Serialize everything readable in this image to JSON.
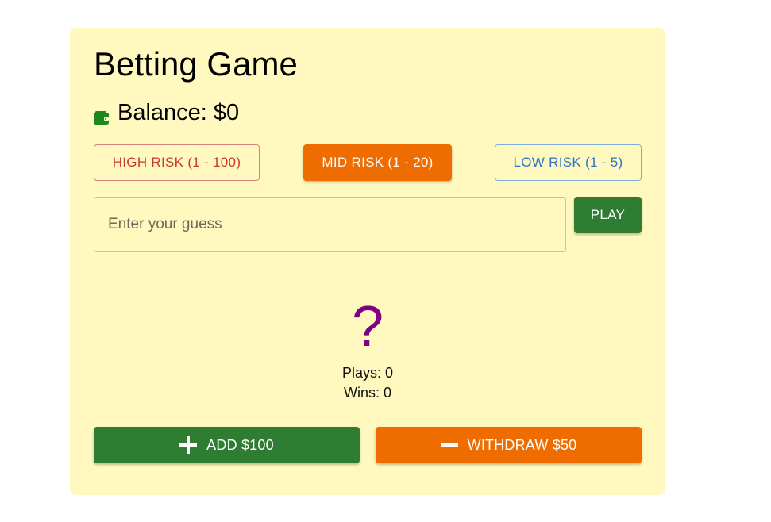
{
  "app": {
    "title": "Betting Game"
  },
  "balance": {
    "label": "Balance: $0",
    "icon": "wallet-icon",
    "icon_color": "#1b8a1b"
  },
  "risk_levels": {
    "high": "HIGH RISK (1 - 100)",
    "mid": "MID RISK (1 - 20)",
    "low": "LOW RISK (1 - 5)",
    "selected": "mid"
  },
  "guess": {
    "placeholder": "Enter your guess",
    "value": "",
    "play_label": "PLAY"
  },
  "result": {
    "symbol": "?",
    "plays": "Plays: 0",
    "wins": "Wins: 0"
  },
  "actions": {
    "add_label": "ADD $100",
    "add_icon": "plus-icon",
    "withdraw_label": "WITHDRAW $50",
    "withdraw_icon": "minus-icon"
  },
  "colors": {
    "card_background": "#fff8bf",
    "high_risk": "#c8382c",
    "mid_risk": "#ef6c00",
    "low_risk": "#2f74c8",
    "play": "#2e7d32",
    "add": "#2e7d32",
    "withdraw": "#ef6c00",
    "mystery": "#800080"
  }
}
